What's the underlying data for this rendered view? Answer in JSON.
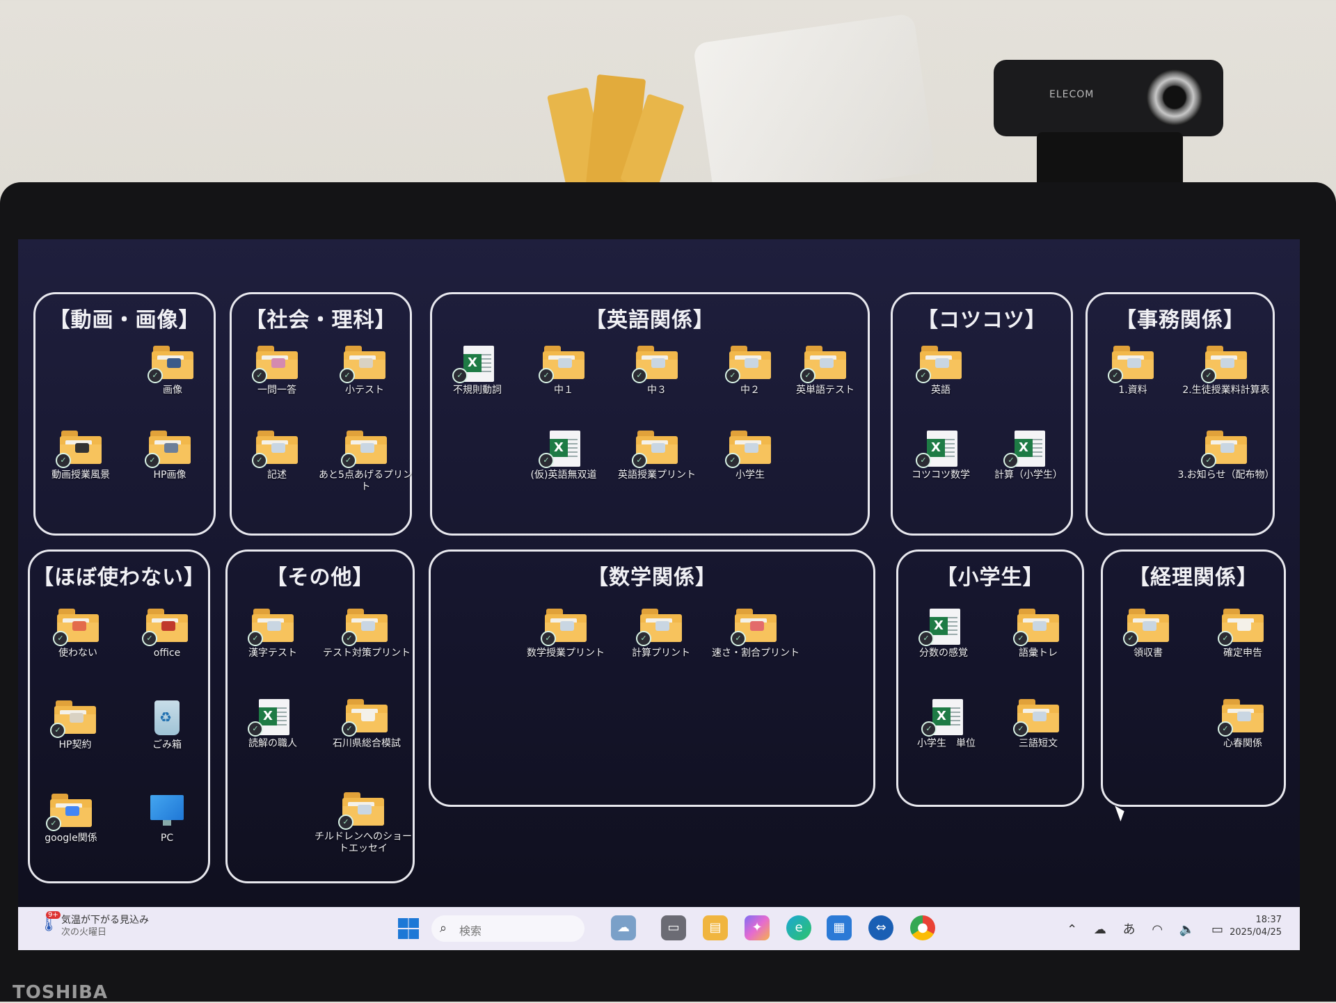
{
  "device": {
    "laptop_brand": "TOSHIBA",
    "webcam_brand": "ELECOM"
  },
  "desktop": {
    "groups": {
      "video_image": {
        "title": "【動画・画像】",
        "items": [
          "画像",
          "動画授業風景",
          "HP画像"
        ]
      },
      "social_science": {
        "title": "【社会・理科】",
        "items": [
          "一問一答",
          "小テスト",
          "記述",
          "あと5点あげるプリント"
        ]
      },
      "english": {
        "title": "【英語関係】",
        "items": [
          "不規則動詞",
          "中１",
          "中３",
          "中２",
          "英単語テスト",
          "(仮)英語無双道",
          "英語授業プリント",
          "小学生"
        ]
      },
      "steady": {
        "title": "【コツコツ】",
        "items": [
          "英語",
          "コツコツ数学",
          "計算（小学生）"
        ]
      },
      "office_admin": {
        "title": "【事務関係】",
        "items": [
          "1.資料",
          "2.生徒授業料計算表",
          "3.お知らせ（配布物）"
        ]
      },
      "rarely_used": {
        "title": "【ほぼ使わない】",
        "items": [
          "使わない",
          "office",
          "HP契約",
          "ごみ箱",
          "google関係",
          "PC"
        ]
      },
      "other": {
        "title": "【その他】",
        "items": [
          "漢字テスト",
          "テスト対策プリント",
          "読解の職人",
          "石川県総合模試",
          "チルドレンへのショートエッセイ"
        ]
      },
      "math": {
        "title": "【数学関係】",
        "items": [
          "数学授業プリント",
          "計算プリント",
          "速さ・割合プリント"
        ]
      },
      "elementary": {
        "title": "【小学生】",
        "items": [
          "分数の感覚",
          "語彙トレ",
          "小学生　単位",
          "三語短文"
        ]
      },
      "accounting": {
        "title": "【経理関係】",
        "items": [
          "領収書",
          "確定申告",
          "心春関係"
        ]
      }
    }
  },
  "taskbar": {
    "weather_badge": "9+",
    "weather_line1": "気温が下がる見込み",
    "weather_line2": "次の火曜日",
    "search_placeholder": "検索",
    "tray_ime": "あ",
    "time": "18:37",
    "date": "2025/04/25"
  },
  "colors": {
    "folder": "#f2b84b",
    "excel": "#1e7b45",
    "desktop_bg": "#1a1a33",
    "taskbar": "#ece9f6"
  }
}
